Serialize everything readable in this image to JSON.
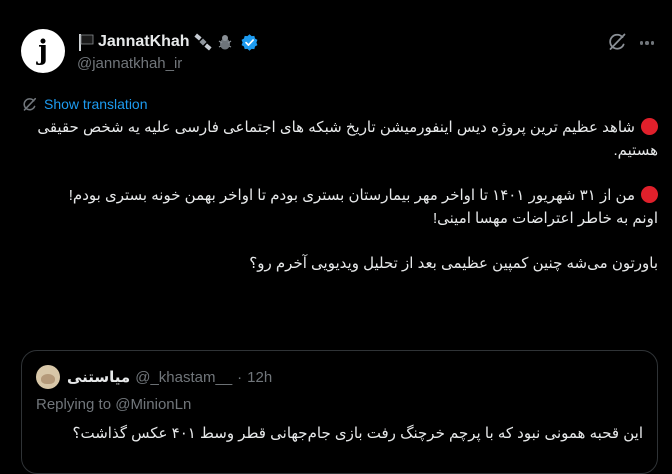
{
  "author": {
    "avatar_letter": "j",
    "display_name": "JannatKhah",
    "handle": "@jannatkhah_ir",
    "name_decorations": [
      "black-flag-icon",
      "satellite-icon",
      "bug-icon"
    ],
    "verified": true
  },
  "translate": {
    "label": "Show translation"
  },
  "tweet": {
    "para1": "شاهد عظیم ترین پروژه دیس اینفورمیشن تاریخ شبکه های اجتماعی فارسی علیه یه شخص حقیقی هستیم.",
    "para2": "من از ۳۱ شهریور ۱۴۰۱ تا اواخر مهر بیمارستان بستری بودم تا اواخر بهمن خونه بستری بودم!",
    "para3": "اونم به خاطر اعتراضات مهسا امینی!",
    "para4": "باورتون می‌شه چنین کمپین عظیمی بعد از تحلیل ویدیویی آخرم رو؟"
  },
  "quote": {
    "display_name": "میاستنی",
    "handle": "@_khastam__",
    "separator": "·",
    "time": "12h",
    "replying_to": "Replying to @MinionLn",
    "text": "این قحبه همونی نبود که با پرچم خرچنگ رفت بازی جام‌جهانی قطر وسط ۴۰۱ عکس گذاشت؟"
  },
  "colors": {
    "background": "#000000",
    "text": "#e7e9ea",
    "secondary": "#71767b",
    "link": "#1d9bf0",
    "verified": "#1d9bf0",
    "red_circle": "#e0202b",
    "border": "#2f3336"
  }
}
